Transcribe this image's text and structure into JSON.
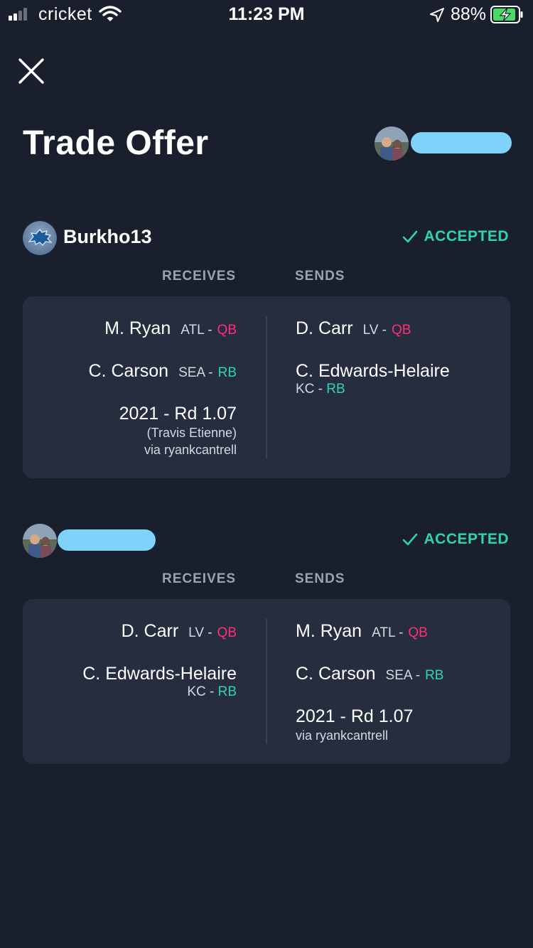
{
  "status_bar": {
    "carrier": "cricket",
    "time": "11:23 PM",
    "battery": "88%"
  },
  "header": {
    "title": "Trade Offer"
  },
  "colors": {
    "background": "#1a1f2e",
    "card": "#262d3e",
    "accent_green": "#2dd4ad",
    "qb_pink": "#ff2e78",
    "redaction": "#7fd3fb"
  },
  "trades": [
    {
      "party_name": "Burkho13",
      "status": "ACCEPTED",
      "receives_label": "RECEIVES",
      "sends_label": "SENDS",
      "receives": [
        {
          "name": "M. Ryan",
          "team": "ATL -",
          "pos": "QB"
        },
        {
          "name": "C. Carson",
          "team": "SEA -",
          "pos": "RB"
        },
        {
          "title": "2021 - Rd 1.07",
          "note": "(Travis Etienne)",
          "via": "via ryankcantrell"
        }
      ],
      "sends": [
        {
          "name": "D. Carr",
          "team": "LV -",
          "pos": "QB"
        },
        {
          "name": "C. Edwards-Helaire",
          "team": "KC -",
          "pos": "RB"
        }
      ]
    },
    {
      "party_name": "",
      "status": "ACCEPTED",
      "receives_label": "RECEIVES",
      "sends_label": "SENDS",
      "receives": [
        {
          "name": "D. Carr",
          "team": "LV -",
          "pos": "QB"
        },
        {
          "name": "C. Edwards-Helaire",
          "team": "KC -",
          "pos": "RB"
        }
      ],
      "sends": [
        {
          "name": "M. Ryan",
          "team": "ATL -",
          "pos": "QB"
        },
        {
          "name": "C. Carson",
          "team": "SEA -",
          "pos": "RB"
        },
        {
          "title": "2021 - Rd 1.07",
          "via": "via ryankcantrell"
        }
      ]
    }
  ]
}
